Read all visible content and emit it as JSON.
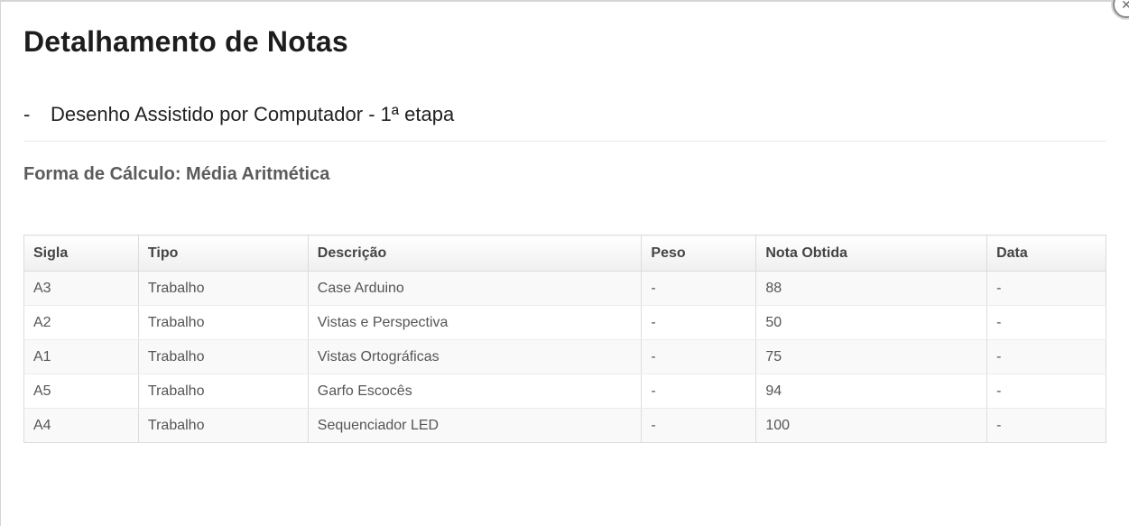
{
  "modal": {
    "title": "Detalhamento de Notas",
    "close_icon": "close-icon",
    "subject_dash": "-",
    "subject": "Desenho Assistido por Computador - 1ª etapa",
    "calculation": "Forma de Cálculo: Média Aritmética"
  },
  "table": {
    "headers": [
      "Sigla",
      "Tipo",
      "Descrição",
      "Peso",
      "Nota Obtida",
      "Data"
    ],
    "rows": [
      [
        "A3",
        "Trabalho",
        "Case Arduino",
        "-",
        "88",
        "-"
      ],
      [
        "A2",
        "Trabalho",
        "Vistas e Perspectiva",
        "-",
        "50",
        "-"
      ],
      [
        "A1",
        "Trabalho",
        "Vistas Ortográficas",
        "-",
        "75",
        "-"
      ],
      [
        "A5",
        "Trabalho",
        "Garfo Escocês",
        "-",
        "94",
        "-"
      ],
      [
        "A4",
        "Trabalho",
        "Sequenciador LED",
        "-",
        "100",
        "-"
      ]
    ]
  }
}
